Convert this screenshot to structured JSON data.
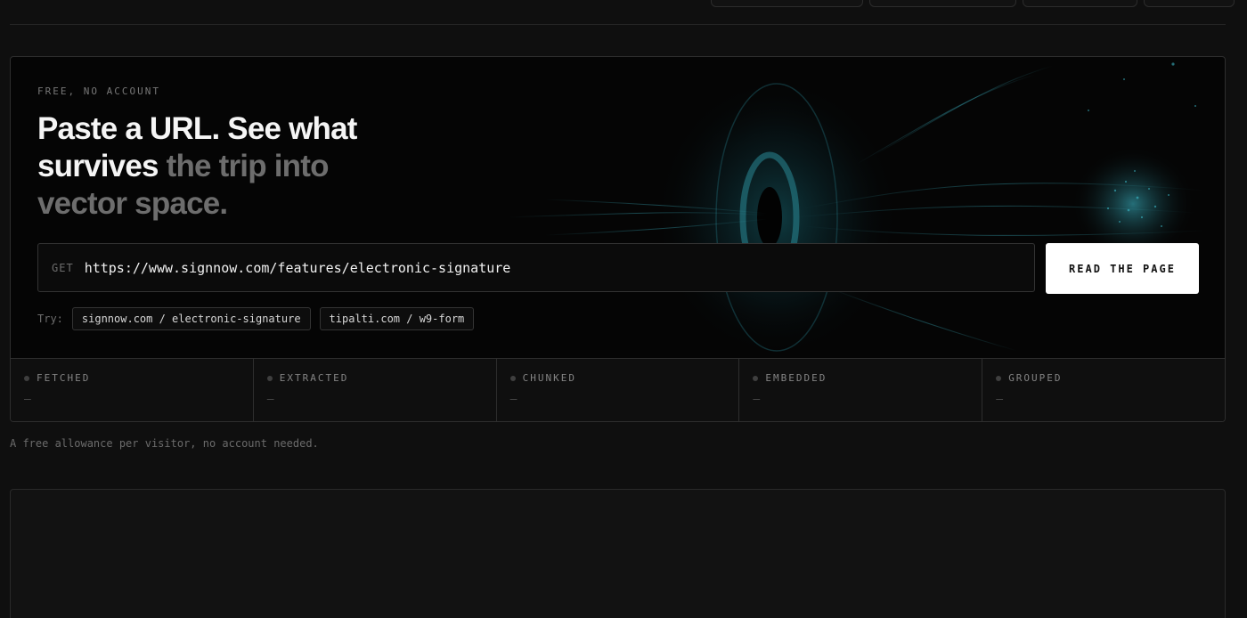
{
  "hero": {
    "eyebrow": "FREE, NO ACCOUNT",
    "headline_bright": "Paste a URL. See what survives",
    "headline_dim": "the trip into vector space.",
    "method": "GET",
    "url_value": "https://www.signnow.com/features/electronic-signature",
    "read_button": "READ THE PAGE",
    "try_label": "Try:",
    "examples": [
      "signnow.com / electronic-signature",
      "tipalti.com / w9-form"
    ]
  },
  "stages": [
    {
      "label": "FETCHED",
      "value": "—"
    },
    {
      "label": "EXTRACTED",
      "value": "—"
    },
    {
      "label": "CHUNKED",
      "value": "—"
    },
    {
      "label": "EMBEDDED",
      "value": "—"
    },
    {
      "label": "GROUPED",
      "value": "—"
    }
  ],
  "allowance_note": "A free allowance per visitor, no account needed.",
  "colors": {
    "background": "#0f0f0f",
    "accent_glow": "#3fc4d6",
    "button_bg": "#ffffff"
  }
}
